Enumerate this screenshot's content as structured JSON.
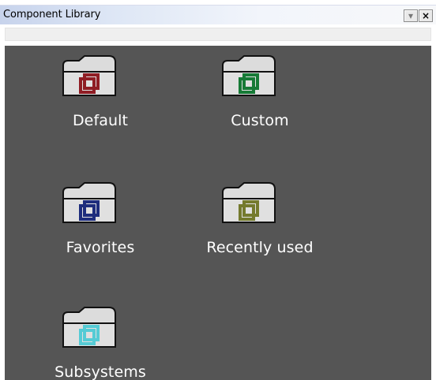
{
  "window": {
    "title": "Component Library",
    "minimize_glyph": "▾",
    "close_glyph": "×"
  },
  "search": {
    "value": "",
    "placeholder": ""
  },
  "library": {
    "items": [
      {
        "label": "Default",
        "icon": "folder-icon",
        "color": "#8f1d24"
      },
      {
        "label": "Custom",
        "icon": "folder-icon",
        "color": "#167a36"
      },
      {
        "label": "Favorites",
        "icon": "folder-icon",
        "color": "#1e2d7d"
      },
      {
        "label": "Recently used",
        "icon": "folder-icon",
        "color": "#747a2d"
      },
      {
        "label": "Subsystems",
        "icon": "folder-icon",
        "color": "#55cbd5"
      }
    ]
  },
  "colors": {
    "library_background": "#555555",
    "item_text": "#ffffff",
    "titlebar_start": "#c7d3ec",
    "titlebar_end": "#f7f8fa"
  }
}
